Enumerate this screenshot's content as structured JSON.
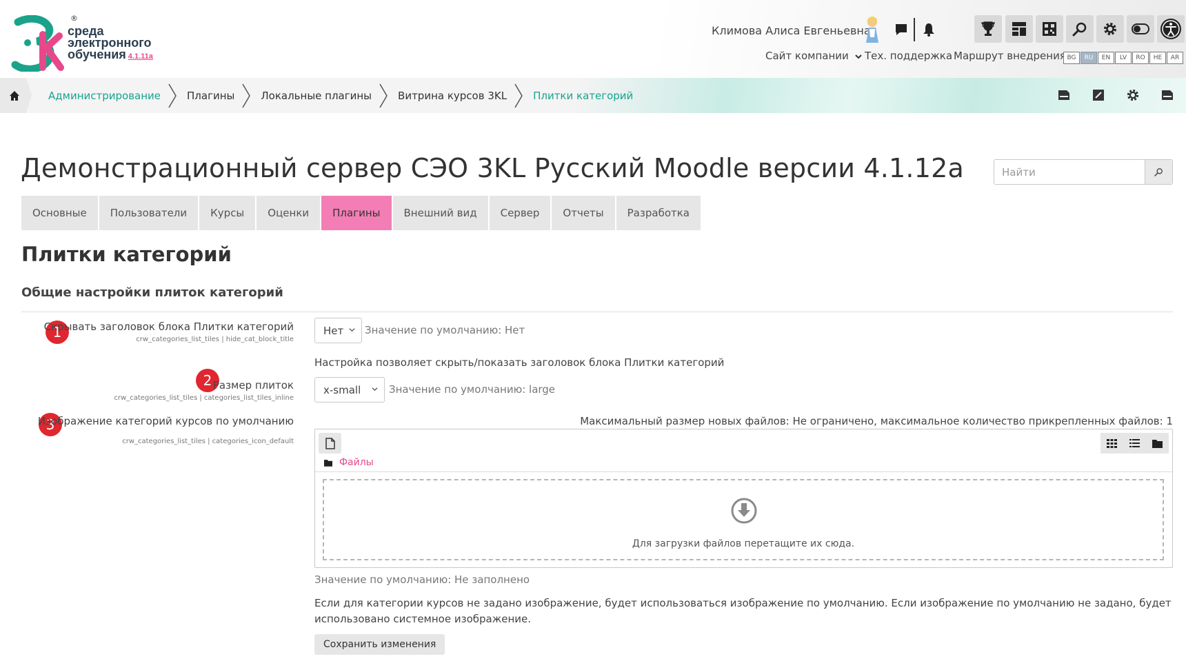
{
  "header": {
    "logo_line1": "среда",
    "logo_line2": "электронного",
    "logo_line3": "обучения",
    "logo_version": "4.1.11a",
    "logo_reg": "®",
    "user_name": "Климова Алиса Евгеньевна",
    "nav_links": {
      "company": "Сайт компании",
      "support": "Тех. поддержка",
      "route": "Маршрут внедрения"
    },
    "languages": [
      "BG",
      "RU",
      "EN",
      "LV",
      "RO",
      "HE",
      "AR"
    ],
    "active_language": "RU",
    "icons": [
      "chat-icon",
      "bell-icon",
      "trophy-icon",
      "dashboard-icon",
      "qr-icon",
      "search-icon",
      "gear-icon",
      "toggle-icon",
      "accessibility-icon"
    ]
  },
  "breadcrumb": {
    "items": [
      "Администрирование",
      "Плагины",
      "Локальные плагины",
      "Витрина курсов 3KL",
      "Плитки категорий"
    ]
  },
  "page": {
    "title": "Демонстрационный сервер СЭО 3KL Русский Moodle версии 4.1.12a",
    "search_placeholder": "Найти",
    "tabs": [
      "Основные",
      "Пользователи",
      "Курсы",
      "Оценки",
      "Плагины",
      "Внешний вид",
      "Сервер",
      "Отчеты",
      "Разработка"
    ],
    "active_tab": "Плагины",
    "section_title": "Плитки категорий",
    "subsection_title": "Общие настройки плиток категорий"
  },
  "settings": {
    "hide_title": {
      "badge": "1",
      "label": "Скрывать заголовок блока Плитки категорий",
      "key": "crw_categories_list_tiles | hide_cat_block_title",
      "value": "Нет",
      "default": "Значение по умолчанию: Нет",
      "description": "Настройка позволяет скрыть/показать заголовок блока Плитки категорий"
    },
    "tile_size": {
      "badge": "2",
      "label": "Размер плиток",
      "key": "crw_categories_list_tiles | categories_list_tiles_inline",
      "value": "x-small",
      "default": "Значение по умолчанию: large"
    },
    "default_image": {
      "badge": "3",
      "label": "Изображение категорий курсов по умолчанию",
      "key": "crw_categories_list_tiles | categories_icon_default",
      "limits": "Максимальный размер новых файлов: Не ограничено, максимальное количество прикрепленных файлов: 1",
      "files_label": "Файлы",
      "dropzone_text": "Для загрузки файлов перетащите их сюда.",
      "default": "Значение по умолчанию: Не заполнено",
      "description": "Если для категории курсов не задано изображение, будет использоваться изображение по умолчанию. Если изображение по умолчанию не задано, будет использовано системное изображение."
    }
  },
  "actions": {
    "save": "Сохранить изменения"
  },
  "colors": {
    "accent_pink": "#f37eb5",
    "teal": "#17a48c",
    "badge_red": "#e0262f"
  }
}
